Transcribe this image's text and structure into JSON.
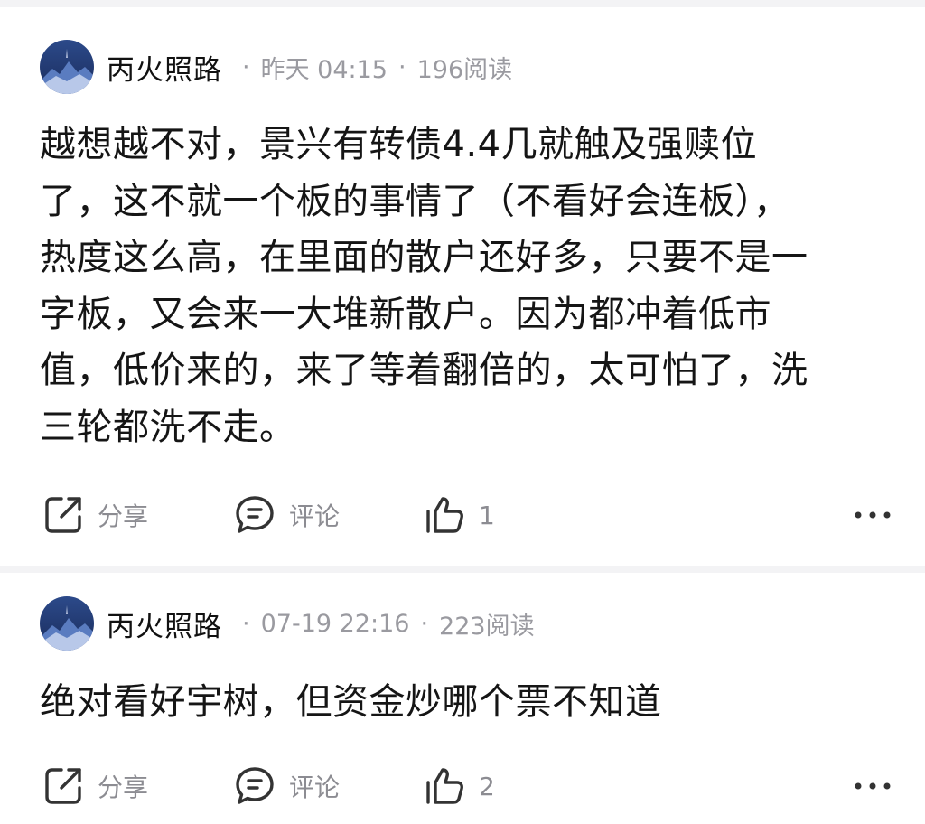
{
  "posts": [
    {
      "author": "丙火照路",
      "time": "昨天 04:15",
      "reads": "196阅读",
      "separator": "·",
      "content_lines": [
        "越想越不对，景兴有转债4.4几就触及强赎位",
        "了，这不就一个板的事情了（不看好会连板），",
        "热度这么高，在里面的散户还好多，只要不是一",
        "字板，又会来一大堆新散户。因为都冲着低市",
        "值，低价来的，来了等着翻倍的，太可怕了，洗",
        "三轮都洗不走。"
      ],
      "actions": {
        "share_label": "分享",
        "comment_label": "评论",
        "like_count": "1"
      }
    },
    {
      "author": "丙火照路",
      "time": "07-19 22:16",
      "reads": "223阅读",
      "separator": "·",
      "content_lines": [
        "绝对看好宇树，但资金炒哪个票不知道"
      ],
      "actions": {
        "share_label": "分享",
        "comment_label": "评论",
        "like_count": "2"
      }
    }
  ],
  "icons": {
    "share": "share-icon",
    "comment": "comment-icon",
    "like": "thumbs-up-icon",
    "more": "more-icon",
    "avatar": "avatar"
  },
  "colors": {
    "text": "#151515",
    "meta": "#9a9aa0",
    "action": "#8c8c92",
    "divider": "#f3f3f5",
    "icon_stroke": "#333333"
  }
}
